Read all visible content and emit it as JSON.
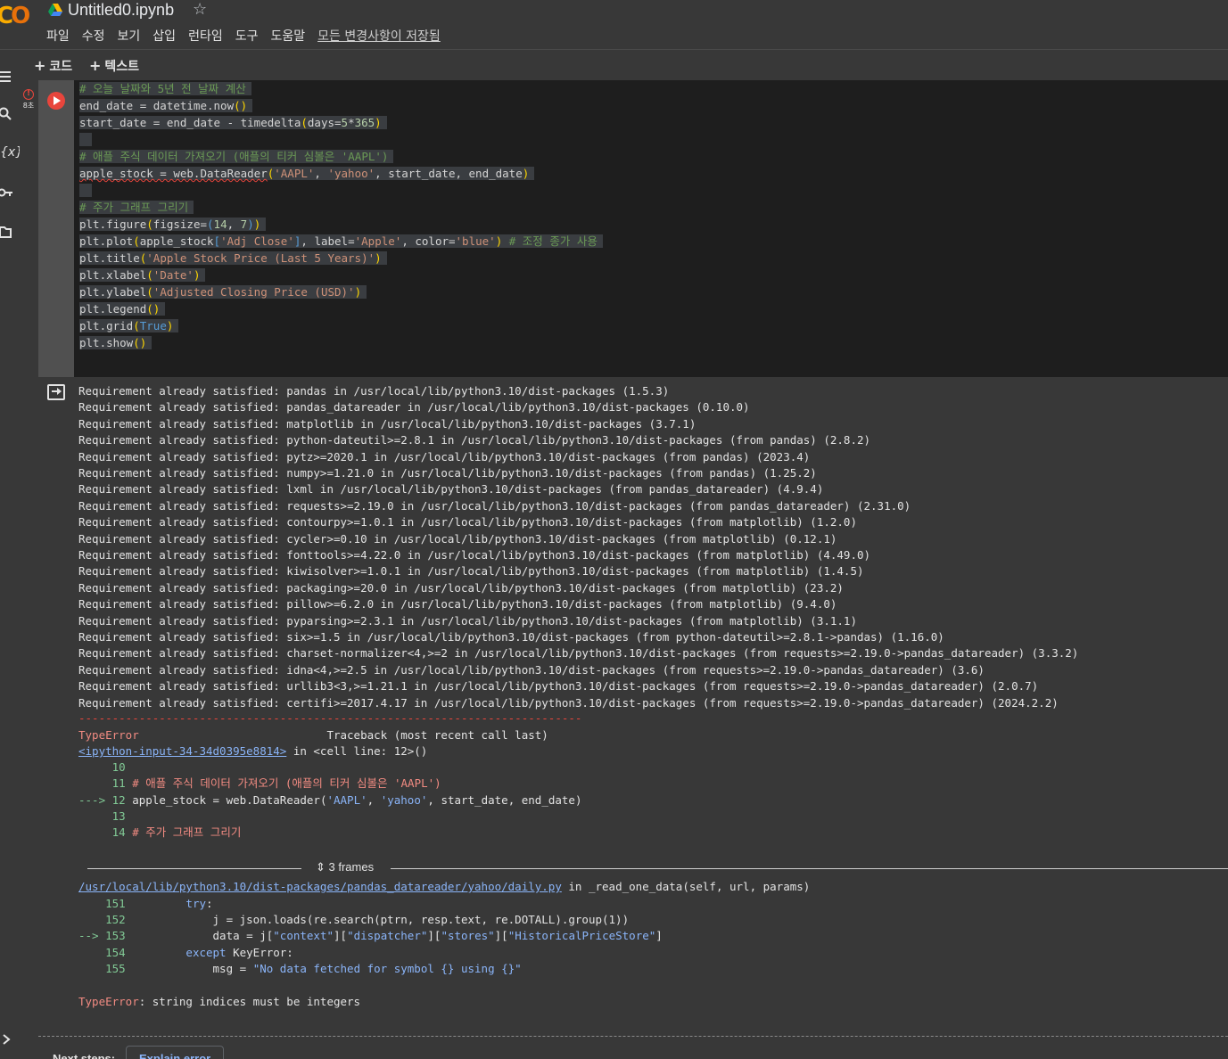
{
  "header": {
    "logo_text_a": "C",
    "logo_text_b": "O",
    "title": "Untitled0.ipynb",
    "star": "☆",
    "menu": [
      "파일",
      "수정",
      "보기",
      "삽입",
      "런타임",
      "도구",
      "도움말"
    ],
    "saved_status": "모든 변경사항이 저장됨"
  },
  "toolbar": {
    "add_code": "코드",
    "add_text": "텍스트"
  },
  "rail": {
    "icons": [
      "menu-icon",
      "search-icon",
      "variables-icon",
      "key-icon",
      "folder-icon",
      "expand-icon"
    ]
  },
  "cell": {
    "status_icon": "!",
    "exec_time": "8초",
    "code_lines": [
      "# 오늘 날짜와 5년 전 날짜 계산",
      "end_date = datetime.now()",
      "start_date = end_date - timedelta(days=5*365)",
      "",
      "# 애플 주식 데이터 가져오기 (애플의 티커 심볼은 'AAPL')",
      "apple_stock = web.DataReader('AAPL', 'yahoo', start_date, end_date)",
      "",
      "# 주가 그래프 그리기",
      "plt.figure(figsize=(14, 7))",
      "plt.plot(apple_stock['Adj Close'], label='Apple', color='blue') # 조정 종가 사용",
      "plt.title('Apple Stock Price (Last 5 Years)')",
      "plt.xlabel('Date')",
      "plt.ylabel('Adjusted Closing Price (USD)')",
      "plt.legend()",
      "plt.grid(True)",
      "plt.show()"
    ]
  },
  "output": {
    "requirements": [
      "Requirement already satisfied: pandas in /usr/local/lib/python3.10/dist-packages (1.5.3)",
      "Requirement already satisfied: pandas_datareader in /usr/local/lib/python3.10/dist-packages (0.10.0)",
      "Requirement already satisfied: matplotlib in /usr/local/lib/python3.10/dist-packages (3.7.1)",
      "Requirement already satisfied: python-dateutil>=2.8.1 in /usr/local/lib/python3.10/dist-packages (from pandas) (2.8.2)",
      "Requirement already satisfied: pytz>=2020.1 in /usr/local/lib/python3.10/dist-packages (from pandas) (2023.4)",
      "Requirement already satisfied: numpy>=1.21.0 in /usr/local/lib/python3.10/dist-packages (from pandas) (1.25.2)",
      "Requirement already satisfied: lxml in /usr/local/lib/python3.10/dist-packages (from pandas_datareader) (4.9.4)",
      "Requirement already satisfied: requests>=2.19.0 in /usr/local/lib/python3.10/dist-packages (from pandas_datareader) (2.31.0)",
      "Requirement already satisfied: contourpy>=1.0.1 in /usr/local/lib/python3.10/dist-packages (from matplotlib) (1.2.0)",
      "Requirement already satisfied: cycler>=0.10 in /usr/local/lib/python3.10/dist-packages (from matplotlib) (0.12.1)",
      "Requirement already satisfied: fonttools>=4.22.0 in /usr/local/lib/python3.10/dist-packages (from matplotlib) (4.49.0)",
      "Requirement already satisfied: kiwisolver>=1.0.1 in /usr/local/lib/python3.10/dist-packages (from matplotlib) (1.4.5)",
      "Requirement already satisfied: packaging>=20.0 in /usr/local/lib/python3.10/dist-packages (from matplotlib) (23.2)",
      "Requirement already satisfied: pillow>=6.2.0 in /usr/local/lib/python3.10/dist-packages (from matplotlib) (9.4.0)",
      "Requirement already satisfied: pyparsing>=2.3.1 in /usr/local/lib/python3.10/dist-packages (from matplotlib) (3.1.1)",
      "Requirement already satisfied: six>=1.5 in /usr/local/lib/python3.10/dist-packages (from python-dateutil>=2.8.1->pandas) (1.16.0)",
      "Requirement already satisfied: charset-normalizer<4,>=2 in /usr/local/lib/python3.10/dist-packages (from requests>=2.19.0->pandas_datareader) (3.3.2)",
      "Requirement already satisfied: idna<4,>=2.5 in /usr/local/lib/python3.10/dist-packages (from requests>=2.19.0->pandas_datareader) (3.6)",
      "Requirement already satisfied: urllib3<3,>=1.21.1 in /usr/local/lib/python3.10/dist-packages (from requests>=2.19.0->pandas_datareader) (2.0.7)",
      "Requirement already satisfied: certifi>=2017.4.17 in /usr/local/lib/python3.10/dist-packages (from requests>=2.19.0->pandas_datareader) (2024.2.2)"
    ],
    "separator": "---------------------------------------------------------------------------",
    "error_type": "TypeError",
    "traceback_header": "Traceback (most recent call last)",
    "input_link": "<ipython-input-34-34d0395e8814>",
    "input_loc": " in <cell line: 12>()",
    "tb1_lines": [
      {
        "prefix": "     ",
        "num": "10",
        "text": ""
      },
      {
        "prefix": "     ",
        "num": "11",
        "text": " # 애플 주식 데이터 가져오기 (애플의 티커 심볼은 'AAPL')"
      },
      {
        "prefix": "---> ",
        "num": "12",
        "text": " apple_stock = web.DataReader('AAPL', 'yahoo', start_date, end_date)"
      },
      {
        "prefix": "     ",
        "num": "13",
        "text": ""
      },
      {
        "prefix": "     ",
        "num": "14",
        "text": " # 주가 그래프 그리기"
      }
    ],
    "frames_label": "3 frames",
    "file_link": "/usr/local/lib/python3.10/dist-packages/pandas_datareader/yahoo/daily.py",
    "file_loc": " in _read_one_data(self, url, params)",
    "tb2_lines": [
      {
        "prefix": "    ",
        "num": "151",
        "text": "         try:"
      },
      {
        "prefix": "    ",
        "num": "152",
        "text": "             j = json.loads(re.search(ptrn, resp.text, re.DOTALL).group(1))"
      },
      {
        "prefix": "--> ",
        "num": "153",
        "text": "             data = j[\"context\"][\"dispatcher\"][\"stores\"][\"HistoricalPriceStore\"]"
      },
      {
        "prefix": "    ",
        "num": "154",
        "text": "         except KeyError:"
      },
      {
        "prefix": "    ",
        "num": "155",
        "text": "             msg = \"No data fetched for symbol {} using {}\""
      }
    ],
    "final_error_type": "TypeError",
    "final_error_msg": ": string indices must be integers"
  },
  "next_steps": {
    "label": "Next steps:",
    "button": "Explain error"
  }
}
